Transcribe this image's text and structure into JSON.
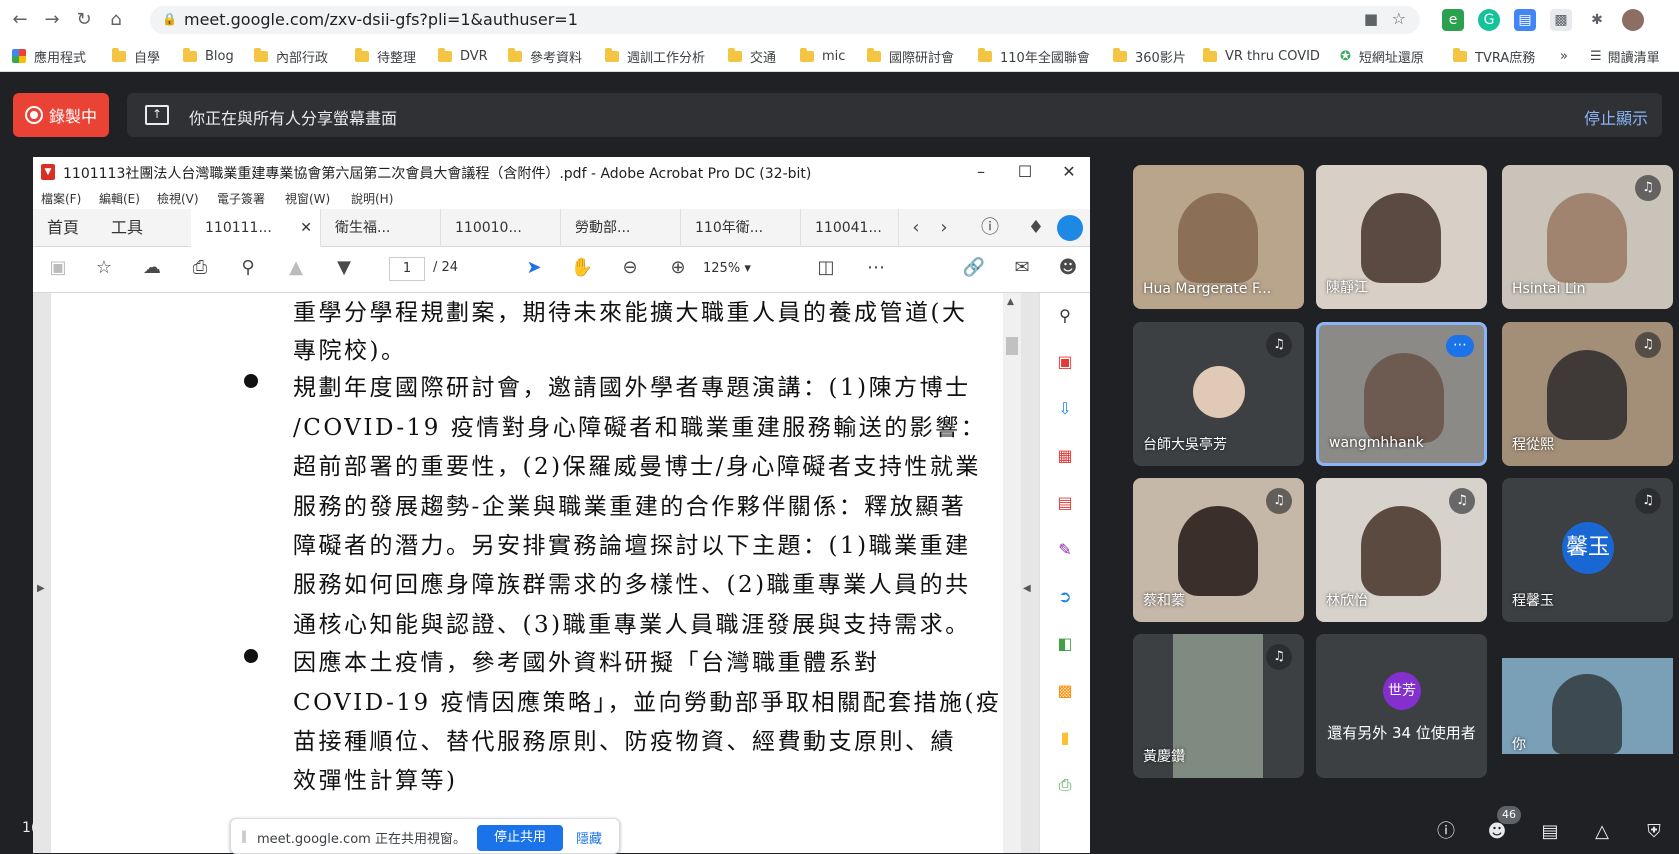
{
  "browser": {
    "url": "meet.google.com/zxv-dsii-gfs?pli=1&authuser=1",
    "bookmarks": [
      "應用程式",
      "自學",
      "Blog",
      "內部行政",
      "待整理",
      "DVR",
      "參考資料",
      "週訓工作分析",
      "交通",
      "mic",
      "國際研討會",
      "110年全國聯會",
      "360影片",
      "VR thru COVID",
      "短網址還原",
      "TVRA庶務",
      "»",
      "閱讀清單"
    ]
  },
  "meet": {
    "recording_label": "錄製中",
    "share_message": "你正在與所有人分享螢幕畫面",
    "stop_showing": "停止顯示",
    "participants_count": "46",
    "participants": [
      {
        "name": "Hua Margerate F...",
        "muted": false
      },
      {
        "name": "陳靜江",
        "muted": false
      },
      {
        "name": "Hsintai Lin",
        "muted": true
      },
      {
        "name": "台師大吳亭芳",
        "muted": true
      },
      {
        "name": "wangmhhank",
        "muted": false
      },
      {
        "name": "程從熙",
        "muted": true
      },
      {
        "name": "蔡和蓁",
        "muted": true
      },
      {
        "name": "林欣怡",
        "muted": true
      },
      {
        "name": "程馨玉",
        "muted": true,
        "avatar": "馨玉"
      },
      {
        "name": "黃慶鑽",
        "muted": true
      },
      {
        "name": "還有另外 34 位使用者",
        "avatar": "世芳"
      },
      {
        "name": "你",
        "muted": false
      }
    ],
    "sharing_pill": {
      "text": "meet.google.com 正在共用視窗。",
      "stop_button": "停止共用",
      "hide_button": "隱藏"
    },
    "colors": {
      "record_red": "#ea4335",
      "accent_blue": "#1a73e8",
      "avatar_blue": "#1967d2",
      "avatar_purple": "#8430ce"
    }
  },
  "acrobat": {
    "title": "1101113社團法人台灣職業重建專業協會第六屆第二次會員大會議程（含附件）.pdf - Adobe Acrobat Pro DC (32-bit)",
    "menu": [
      "檔案(F)",
      "編輯(E)",
      "檢視(V)",
      "電子簽署",
      "視窗(W)",
      "說明(H)"
    ],
    "home_tab": "首頁",
    "tools_tab": "工具",
    "tabs": [
      "110111...",
      "衛生福...",
      "110010...",
      "勞動部...",
      "110年衛...",
      "110041..."
    ],
    "page_current": "1",
    "page_total": "/ 24",
    "zoom": "125%",
    "document_lines": [
      "重學分學程規劃案，期待未來能擴大職重人員的養成管道(大",
      "專院校)。",
      "規劃年度國際研討會，邀請國外學者專題演講：(1)陳方博士",
      "/COVID-19 疫情對身心障礙者和職業重建服務輸送的影響：",
      "超前部署的重要性，(2)保羅威曼博士/身心障礙者支持性就業",
      "服務的發展趨勢-企業與職業重建的合作夥伴關係：釋放顯著",
      "障礙者的潛力。另安排實務論壇探討以下主題：(1)職業重建",
      "服務如何回應身障族群需求的多樣性、(2)職重專業人員的共",
      "通核心知能與認證、(3)職重專業人員職涯發展與支持需求。",
      "因應本土疫情，參考國外資料研擬「台灣職重體系對",
      "COVID-19 疫情因應策略」，並向勞動部爭取相關配套措施(疫",
      "苗接種順位、替代服務原則、防疫物資、經費動支原則、績",
      "效彈性計算等)"
    ]
  },
  "footer": {
    "page_corner": "1("
  }
}
